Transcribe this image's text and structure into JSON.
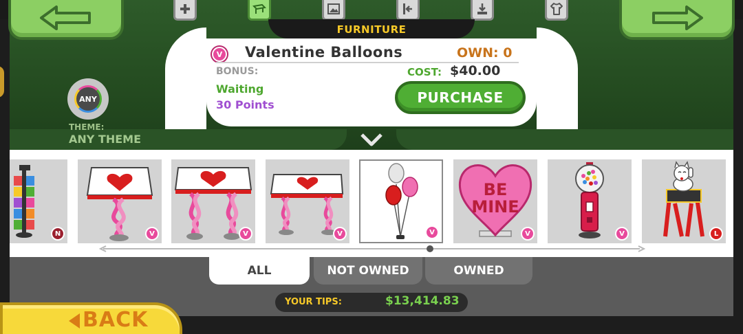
{
  "category": {
    "label": "FURNITURE"
  },
  "tabs": [
    {
      "name": "plus",
      "active": false
    },
    {
      "name": "furniture",
      "active": true
    },
    {
      "name": "picture",
      "active": false
    },
    {
      "name": "door",
      "active": false
    },
    {
      "name": "floor",
      "active": false
    },
    {
      "name": "shirt",
      "active": false
    }
  ],
  "item": {
    "badge": "V",
    "name": "Valentine Balloons",
    "own": "OWN: 0",
    "bonus_label": "BONUS:",
    "cost_label": "COST:",
    "cost_value": "$40.00",
    "status": "Waiting",
    "points": "30 Points",
    "purchase_label": "PURCHASE"
  },
  "theme": {
    "badge": "ANY",
    "label": "THEME:",
    "value": "ANY THEME"
  },
  "shelf_items": [
    {
      "name": "magazine rack",
      "badge": "N"
    },
    {
      "name": "heart table single",
      "badge": "V"
    },
    {
      "name": "heart table double",
      "badge": "V"
    },
    {
      "name": "heart table long",
      "badge": "V"
    },
    {
      "name": "valentine balloons",
      "badge": "V",
      "selected": true
    },
    {
      "name": "be mine heart sign",
      "badge": "V",
      "text": [
        "BE",
        "MINE"
      ]
    },
    {
      "name": "gumball machine",
      "badge": "V"
    },
    {
      "name": "lucky cat statue",
      "badge": "L"
    }
  ],
  "filters": [
    {
      "label": "ALL",
      "active": true
    },
    {
      "label": "NOT OWNED",
      "active": false
    },
    {
      "label": "OWNED",
      "active": false
    }
  ],
  "tips": {
    "label": "YOUR TIPS:",
    "value": "$13,414.83"
  },
  "back": {
    "label": "BACK"
  },
  "colors": {
    "green_panel": "#2e5b2a",
    "purchase": "#4fae34",
    "cost_green": "#4ea72f",
    "own_orange": "#c8741c",
    "points_purple": "#a04fd1",
    "valentine_pink": "#e84a9c",
    "tips_yellow": "#f7c928",
    "back_yellow": "#f7d93a"
  }
}
